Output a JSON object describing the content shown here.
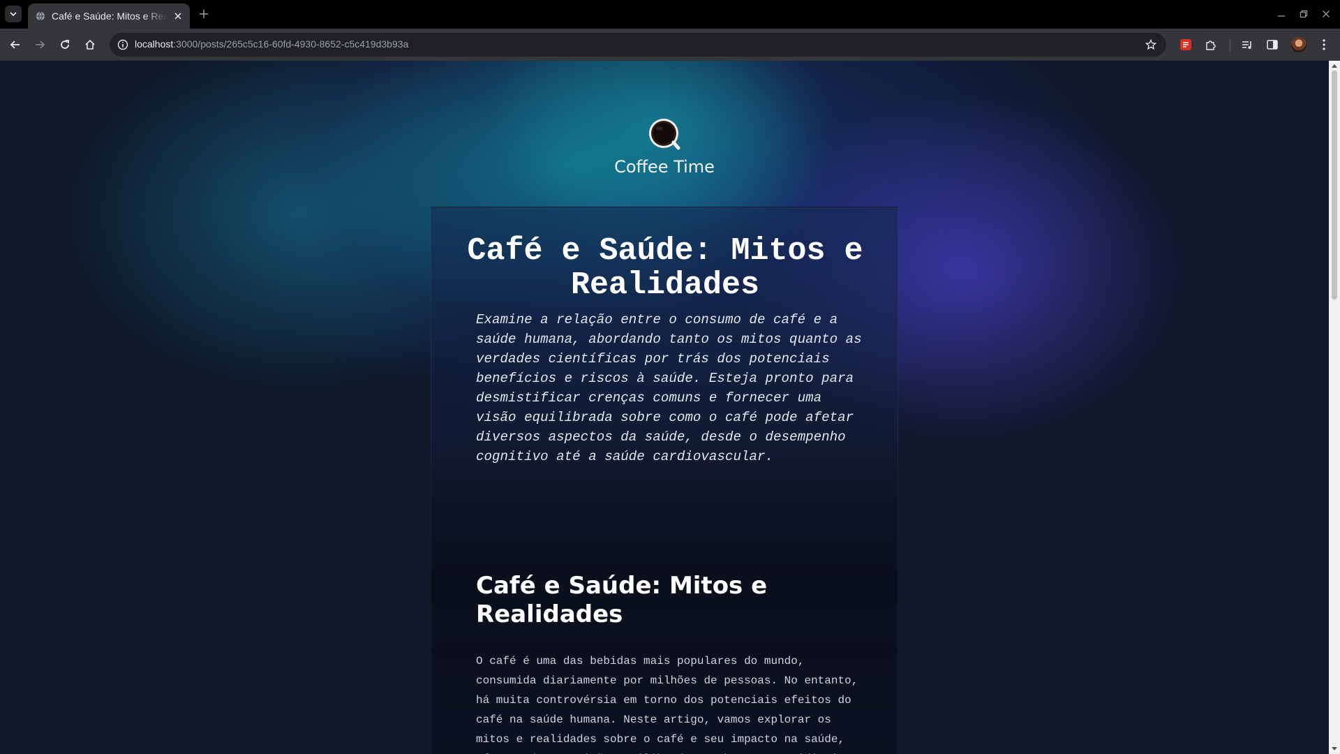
{
  "browser": {
    "tab_title": "Café e Saúde: Mitos e Realidades",
    "url_host": "localhost",
    "url_path": ":3000/posts/265c5c16-60fd-4930-8652-c5c419d3b93a",
    "icons": [
      "tab-search-icon",
      "globe-icon",
      "close-icon",
      "plus-icon",
      "back-icon",
      "forward-icon",
      "reload-icon",
      "home-icon",
      "info-icon",
      "star-icon",
      "extension-icon",
      "puzzle-icon",
      "media-icon",
      "sidepanel-icon",
      "kebab-menu-icon"
    ]
  },
  "site": {
    "name": "Coffee Time"
  },
  "post": {
    "title": "Café e Saúde: Mitos e Realidades",
    "excerpt": "Examine a relação entre o consumo de café e a saúde humana, abordando tanto os mitos quanto as verdades científicas por trás dos potenciais benefícios e riscos à saúde. Esteja pronto para desmistificar crenças comuns e fornecer uma visão equilibrada sobre como o café pode afetar diversos aspectos da saúde, desde o desempenho cognitivo até a saúde cardiovascular.",
    "heading": "Café e Saúde: Mitos e Realidades",
    "paragraph": "O café é uma das bebidas mais populares do mundo, consumida diariamente por milhões de pessoas. No entanto, há muita controvérsia em torno dos potenciais efeitos do café na saúde humana. Neste artigo, vamos explorar os mitos e realidades sobre o café e seu impacto na saúde, oferecendo uma visão equilibrada com base nas evidências científicas disponíveis."
  },
  "colors": {
    "page_background": "#0f1729",
    "accent_teal": "#11788c",
    "accent_indigo": "#463cbe"
  }
}
